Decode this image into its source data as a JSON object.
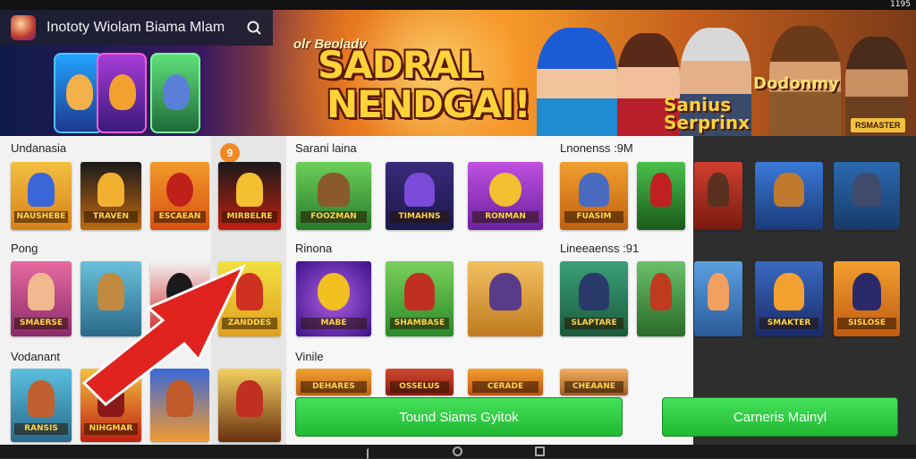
{
  "status": {
    "left": "",
    "center": "",
    "right": "1195"
  },
  "header": {
    "title": "Inototy Wiolam Biama Mlam",
    "search_icon": "search-icon"
  },
  "banner": {
    "kicker": "olr Beoladv",
    "headline_line1": "SADRAL",
    "headline_line2": "NENDGAI!",
    "promo_left": "Sanius\nSerprinx",
    "promo_right": "Dodonmy",
    "badge": "RSMASTER"
  },
  "sections": {
    "left": [
      {
        "label": "Undanasia"
      },
      {
        "label": "Pong"
      },
      {
        "label": "Vodanant"
      }
    ],
    "main": [
      {
        "label": "Sarani laina"
      },
      {
        "label": "Rinona"
      },
      {
        "label": "Vinile"
      }
    ],
    "main_right_labels": [
      "Lnonenss :9M",
      "Lineeaenss :91"
    ]
  },
  "coin_badge": "9",
  "tiles": {
    "row1": [
      "NAUSHEBE",
      "TRAVEN",
      "ESCAEAN",
      "MIRBELRE",
      "FOOZMAN",
      "TIMAHNS",
      "RONMAN",
      "FUASIM",
      "",
      "",
      "",
      ""
    ],
    "row2": [
      "SMAERSE",
      "",
      "",
      "ZANDDES",
      "MABE",
      "SHAMBASE",
      "",
      "SLAPTARE",
      "",
      "",
      "SMAKTER",
      "SISLOSE"
    ],
    "row3": [
      "RANSIS",
      "NIHGMAR",
      "",
      "",
      "DEHARES",
      "OSSELUS",
      "CERADE",
      "CHEAANE",
      "",
      "",
      "",
      ""
    ]
  },
  "buttons": {
    "primary": "Tound Siams Gyitok",
    "secondary": "Carneris Mainyl"
  }
}
